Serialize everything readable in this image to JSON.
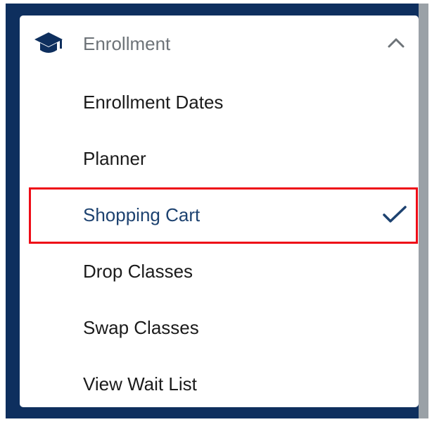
{
  "menu": {
    "header": {
      "label": "Enrollment",
      "icon": "graduation-cap-icon",
      "toggle_icon": "chevron-up-icon",
      "expanded": true
    },
    "items": [
      {
        "label": "Enrollment Dates",
        "selected": false
      },
      {
        "label": "Planner",
        "selected": false
      },
      {
        "label": "Shopping Cart",
        "selected": true,
        "icon": "checkmark-icon"
      },
      {
        "label": "Drop Classes",
        "selected": false
      },
      {
        "label": "Swap Classes",
        "selected": false
      },
      {
        "label": "View Wait List",
        "selected": false
      }
    ]
  },
  "highlight": {
    "target": "Shopping Cart",
    "color": "#ee0c17"
  },
  "colors": {
    "sidebar_background": "#0e2f5e",
    "panel_background": "#ffffff",
    "header_text": "#6d7378",
    "item_text": "#1b1b1b",
    "selected_text": "#1d4270",
    "scrollbar": "#9aa1a7"
  }
}
